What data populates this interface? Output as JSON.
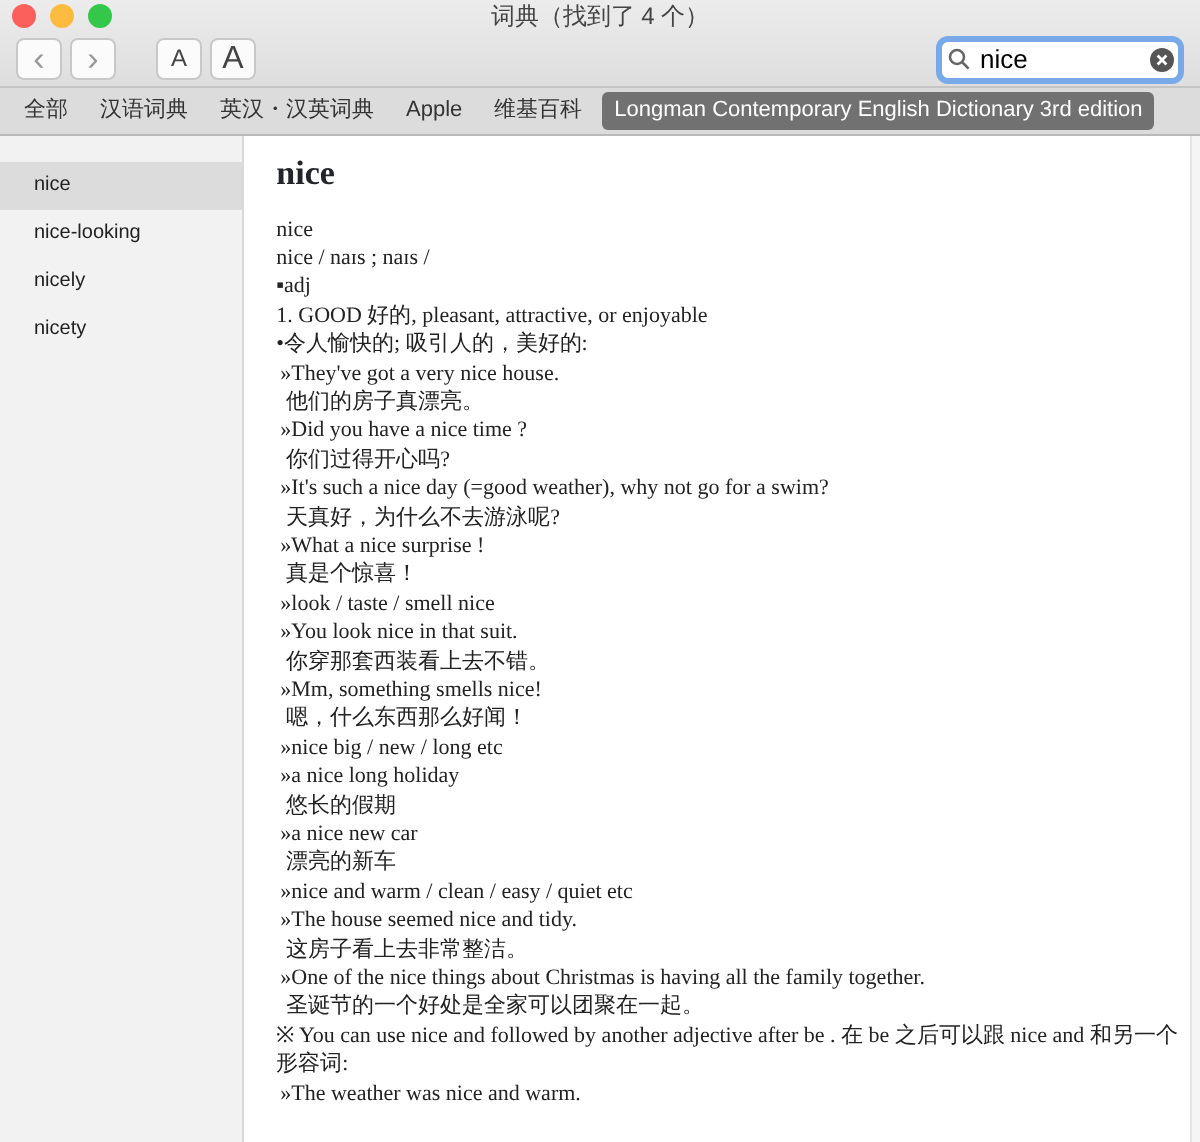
{
  "window": {
    "title": "词典（找到了 4 个）"
  },
  "toolbar": {
    "back": "‹",
    "forward": "›",
    "font_smaller": "A",
    "font_larger": "A"
  },
  "search": {
    "value": "nice"
  },
  "tabs": [
    {
      "label": "全部",
      "selected": false
    },
    {
      "label": "汉语词典",
      "selected": false
    },
    {
      "label": "英汉・汉英词典",
      "selected": false
    },
    {
      "label": "Apple",
      "selected": false
    },
    {
      "label": "维基百科",
      "selected": false
    },
    {
      "label": "Longman Contemporary English Dictionary 3rd edition",
      "selected": true
    }
  ],
  "sidebar": {
    "items": [
      {
        "label": "nice",
        "selected": true
      },
      {
        "label": "nice-looking",
        "selected": false
      },
      {
        "label": "nicely",
        "selected": false
      },
      {
        "label": "nicety",
        "selected": false
      }
    ]
  },
  "entry": {
    "headword": "nice",
    "lines": [
      {
        "kind": "plain",
        "text": "nice"
      },
      {
        "kind": "plain",
        "text": "nice / naɪs ; naɪs /"
      },
      {
        "kind": "plain",
        "text": "▪adj"
      },
      {
        "kind": "plain",
        "text": "1. GOOD 好的, pleasant, attractive, or enjoyable"
      },
      {
        "kind": "plain",
        "text": "•令人愉快的; 吸引人的，美好的:"
      },
      {
        "kind": "example",
        "text": "»They've got a very nice house."
      },
      {
        "kind": "translation",
        "text": "他们的房子真漂亮。"
      },
      {
        "kind": "example",
        "text": "»Did you have a nice time ?"
      },
      {
        "kind": "translation",
        "text": "你们过得开心吗?"
      },
      {
        "kind": "example",
        "text": "»It's such a nice day (=good weather), why not go for a swim?"
      },
      {
        "kind": "translation",
        "text": "天真好，为什么不去游泳呢?"
      },
      {
        "kind": "example",
        "text": "»What a nice surprise !"
      },
      {
        "kind": "translation",
        "text": "真是个惊喜！"
      },
      {
        "kind": "example",
        "text": "»look / taste / smell nice"
      },
      {
        "kind": "example",
        "text": "»You look nice in that suit."
      },
      {
        "kind": "translation",
        "text": "你穿那套西装看上去不错。"
      },
      {
        "kind": "example",
        "text": "»Mm, something smells nice!"
      },
      {
        "kind": "translation",
        "text": "嗯，什么东西那么好闻！"
      },
      {
        "kind": "example",
        "text": "»nice big / new / long etc"
      },
      {
        "kind": "example",
        "text": "»a nice long holiday"
      },
      {
        "kind": "translation",
        "text": "悠长的假期"
      },
      {
        "kind": "example",
        "text": "»a nice new car"
      },
      {
        "kind": "translation",
        "text": "漂亮的新车"
      },
      {
        "kind": "example",
        "text": "»nice and warm / clean / easy / quiet etc"
      },
      {
        "kind": "example",
        "text": "»The house seemed nice and tidy."
      },
      {
        "kind": "translation",
        "text": "这房子看上去非常整洁。"
      },
      {
        "kind": "example",
        "text": "»One of the nice things about Christmas is having all the family together."
      },
      {
        "kind": "translation",
        "text": "圣诞节的一个好处是全家可以团聚在一起。"
      },
      {
        "kind": "plain",
        "text": "※ You can use nice and followed by another adjective after be . 在 be 之后可以跟 nice and 和另一个形容词:"
      },
      {
        "kind": "example",
        "text": "»The weather was nice and warm."
      }
    ]
  }
}
